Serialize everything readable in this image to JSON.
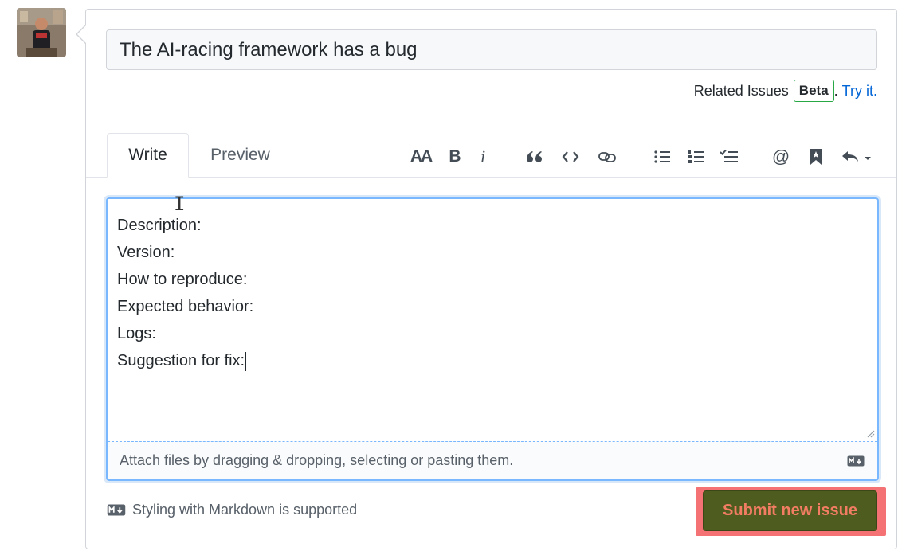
{
  "issue": {
    "title_value": "The AI-racing framework has a bug",
    "related_label": "Related Issues",
    "beta_badge": "Beta",
    "separator": ".",
    "try_link": "Try it."
  },
  "tabs": {
    "write": "Write",
    "preview": "Preview"
  },
  "toolbar": {
    "icons": [
      "text-size-icon",
      "bold-icon",
      "italic-icon",
      "quote-icon",
      "code-icon",
      "link-icon",
      "bullet-list-icon",
      "numbered-list-icon",
      "task-list-icon",
      "mention-icon",
      "saved-reply-icon",
      "reply-icon"
    ],
    "text_size": "AA",
    "bold": "B",
    "italic": "i",
    "mention": "@"
  },
  "editor": {
    "body_text": "Description:\nVersion:\nHow to reproduce:\nExpected behavior:\nLogs:\nSuggestion for fix:",
    "attach_text": "Attach files by dragging & dropping, selecting or pasting them."
  },
  "footer": {
    "markdown_note": "Styling with Markdown is supported",
    "submit_label": "Submit new issue"
  },
  "colors": {
    "link": "#0366d6",
    "beta_border": "#28a745",
    "focus_border": "#79b8ff",
    "submit_bg": "#4e5d1f",
    "submit_text": "#f27d63",
    "highlight": "#f47174"
  }
}
